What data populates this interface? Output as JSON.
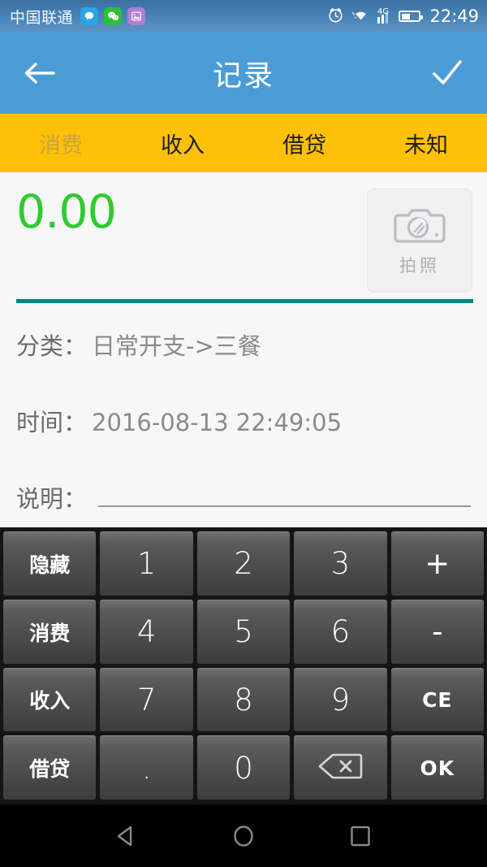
{
  "status_bar": {
    "carrier": "中国联通",
    "notification_icons": [
      "chat-bubble-icon",
      "wechat-icon",
      "photo-icon"
    ],
    "alarm_icon": "alarm-clock-icon",
    "wifi_icon": "wifi-icon",
    "network_type": "4G",
    "signal_icon": "signal-bars-icon",
    "battery_icon": "battery-icon",
    "battery_level": 45,
    "time": "22:49"
  },
  "title_bar": {
    "back_icon": "back-arrow-icon",
    "title": "记录",
    "confirm_icon": "check-icon"
  },
  "tabs": [
    {
      "label": "消费",
      "active": true
    },
    {
      "label": "收入",
      "active": false
    },
    {
      "label": "借贷",
      "active": false
    },
    {
      "label": "未知",
      "active": false
    }
  ],
  "form": {
    "amount": "0.00",
    "amount_color": "#2ecb2e",
    "divider_color": "#00897B",
    "camera": {
      "icon": "camera-icon",
      "label": "拍照"
    },
    "category": {
      "label": "分类：",
      "value": "日常开支->三餐"
    },
    "time": {
      "label": "时间：",
      "value": "2016-08-13  22:49:05"
    },
    "note": {
      "label": "说明：",
      "value": ""
    }
  },
  "keypad": {
    "rows": [
      [
        {
          "label": "隐藏",
          "type": "cn"
        },
        {
          "label": "1",
          "type": "num"
        },
        {
          "label": "2",
          "type": "num"
        },
        {
          "label": "3",
          "type": "num"
        },
        {
          "label": "+",
          "type": "op"
        }
      ],
      [
        {
          "label": "消费",
          "type": "cn"
        },
        {
          "label": "4",
          "type": "num"
        },
        {
          "label": "5",
          "type": "num"
        },
        {
          "label": "6",
          "type": "num"
        },
        {
          "label": "-",
          "type": "op"
        }
      ],
      [
        {
          "label": "收入",
          "type": "cn"
        },
        {
          "label": "7",
          "type": "num"
        },
        {
          "label": "8",
          "type": "num"
        },
        {
          "label": "9",
          "type": "num"
        },
        {
          "label": "CE",
          "type": "word"
        }
      ],
      [
        {
          "label": "借贷",
          "type": "cn"
        },
        {
          "label": ".",
          "type": "num"
        },
        {
          "label": "0",
          "type": "num"
        },
        {
          "label": "",
          "type": "backspace-icon"
        },
        {
          "label": "OK",
          "type": "word"
        }
      ]
    ]
  },
  "nav_bar": {
    "back_icon": "nav-back-triangle-icon",
    "home_icon": "nav-home-circle-icon",
    "recents_icon": "nav-recents-square-icon"
  }
}
